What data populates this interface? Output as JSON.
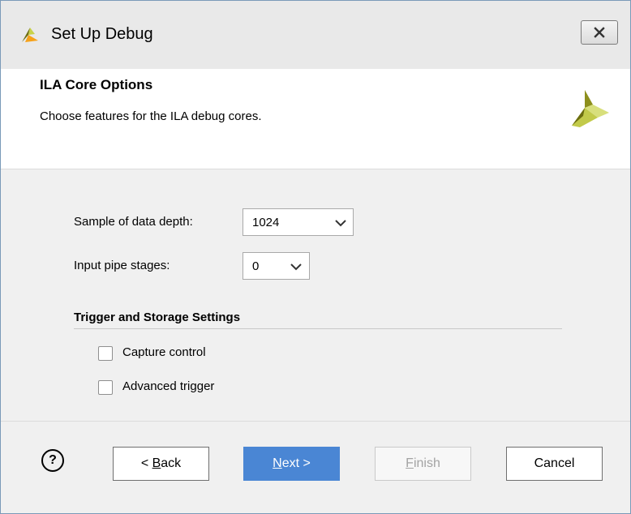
{
  "window": {
    "title": "Set Up Debug",
    "close_glyph": "✕",
    "accent_color": "#4a86d4",
    "icons": {
      "app": "vivado-logo-icon",
      "close": "close-icon",
      "help": "help-icon"
    }
  },
  "header": {
    "title": "ILA Core Options",
    "subtitle": "Choose features for the ILA debug cores."
  },
  "options": {
    "data_depth": {
      "label": "Sample of data depth:",
      "value": "1024"
    },
    "pipe_stages": {
      "label": "Input pipe stages:",
      "value": "0"
    }
  },
  "trigger_section": {
    "title": "Trigger and Storage Settings",
    "capture_control": {
      "label": "Capture control",
      "checked": false
    },
    "advanced_trigger": {
      "label": "Advanced trigger",
      "checked": false
    }
  },
  "footer": {
    "help_glyph": "?",
    "back": {
      "prefix": "< ",
      "mnemonic": "B",
      "rest": "ack"
    },
    "next": {
      "mnemonic": "N",
      "rest": "ext >"
    },
    "finish": {
      "mnemonic": "F",
      "rest": "inish"
    },
    "cancel": "Cancel"
  }
}
